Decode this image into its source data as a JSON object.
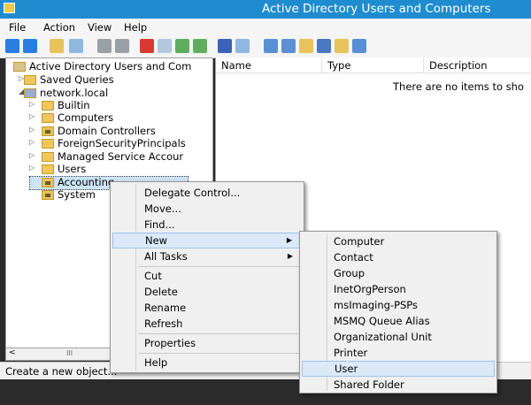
{
  "window": {
    "title": "Active Directory Users and Computers"
  },
  "menubar": [
    "File",
    "Action",
    "View",
    "Help"
  ],
  "tree": {
    "items": [
      {
        "label": "Active Directory Users and Com",
        "icon": "snapin-icon",
        "indent": 0
      },
      {
        "label": "Saved Queries",
        "icon": "folder-icon",
        "indent": 1
      },
      {
        "label": "network.local",
        "icon": "domain-icon",
        "indent": 1
      },
      {
        "label": "Builtin",
        "icon": "folder-icon",
        "indent": 2
      },
      {
        "label": "Computers",
        "icon": "folder-icon",
        "indent": 2
      },
      {
        "label": "Domain Controllers",
        "icon": "ou-icon",
        "indent": 2
      },
      {
        "label": "ForeignSecurityPrincipals",
        "icon": "folder-icon",
        "indent": 2
      },
      {
        "label": "Managed Service Accour",
        "icon": "folder-icon",
        "indent": 2
      },
      {
        "label": "Users",
        "icon": "folder-icon",
        "indent": 2
      },
      {
        "label": "Accounting",
        "icon": "ou-icon",
        "indent": 2
      },
      {
        "label": "System",
        "icon": "ou-icon",
        "indent": 2
      }
    ]
  },
  "list": {
    "columns": [
      "Name",
      "Type",
      "Description"
    ],
    "empty_text": "There are no items to sho"
  },
  "context_menu": {
    "items": [
      "Delegate Control...",
      "Move...",
      "Find...",
      "New",
      "All Tasks",
      "Cut",
      "Delete",
      "Rename",
      "Refresh",
      "Properties",
      "Help"
    ]
  },
  "submenu": {
    "items": [
      "Computer",
      "Contact",
      "Group",
      "InetOrgPerson",
      "msImaging-PSPs",
      "MSMQ Queue Alias",
      "Organizational Unit",
      "Printer",
      "User",
      "Shared Folder"
    ],
    "highlighted": "User"
  },
  "status": {
    "text": "Create a new object..."
  },
  "scroll": {
    "label": "III"
  },
  "colors": {
    "titlebar": "#1f8ccf",
    "highlight": "#dbe9f9"
  }
}
